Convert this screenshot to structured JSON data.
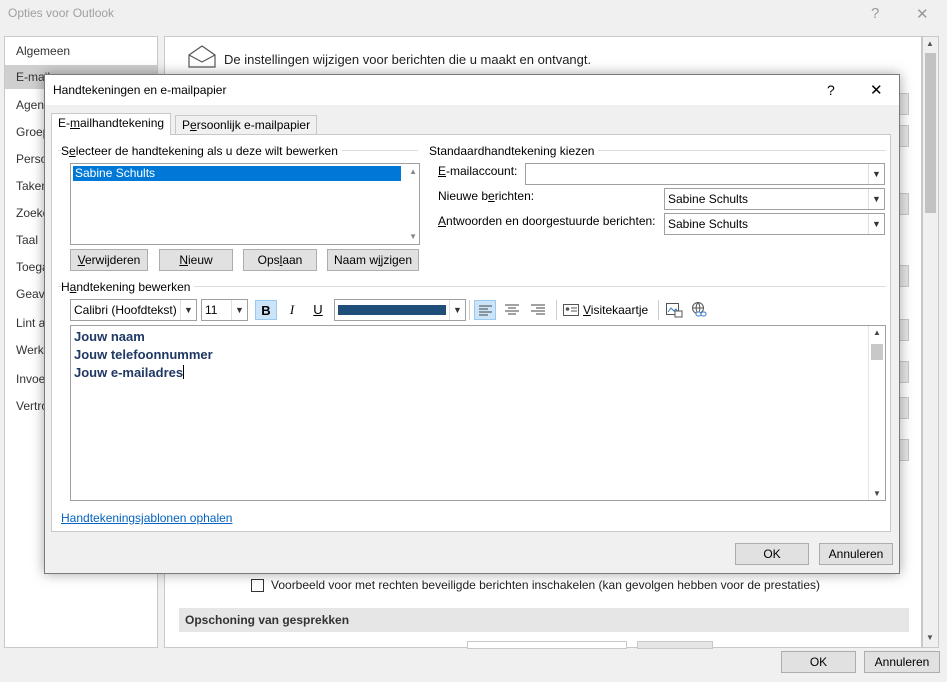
{
  "outer": {
    "title": "Opties voor Outlook",
    "help": "?",
    "close": "✕",
    "sidebar": [
      "Algemeen",
      "E-mail",
      "Agen",
      "Groep",
      "Perso",
      "Taken",
      "Zoeke",
      "Taal",
      "Toega",
      "Geava",
      "Lint a",
      "Werkb",
      "Invoe",
      "Vertro"
    ],
    "header_text": "De instellingen wijzigen voor berichten die u maakt en ontvangt.",
    "checkbox_label": "Voorbeeld voor met rechten beveiligde berichten inschakelen (kan gevolgen hebben voor de prestaties)",
    "section_cleanup": "Opschoning van gesprekken",
    "ok": "OK",
    "cancel": "Annuleren"
  },
  "dialog": {
    "title": "Handtekeningen en e-mailpapier",
    "help": "?",
    "close": "✕",
    "tabs": [
      "E-mailhandtekening",
      "Persoonlijk e-mailpapier"
    ],
    "select_group": "Selecteer de handtekening als u deze wilt bewerken",
    "signatures": [
      "Sabine Schults"
    ],
    "buttons": {
      "delete": "Verwijderen",
      "new": "Nieuw",
      "save": "Opslaan",
      "rename": "Naam wijzigen"
    },
    "default_group": "Standaardhandtekening kiezen",
    "account_label": "E-mailaccount:",
    "account_value": "",
    "new_label": "Nieuwe berichten:",
    "new_value": "Sabine Schults",
    "reply_label": "Antwoorden en doorgestuurde berichten:",
    "reply_value": "Sabine Schults",
    "edit_group": "Handtekening bewerken",
    "font": "Calibri (Hoofdtekst)",
    "size": "11",
    "bold": "B",
    "italic": "I",
    "underline": "U",
    "font_color": "#1f4e79",
    "business_card": "Visitekaartje",
    "signature_lines": [
      "Jouw naam",
      "Jouw telefoonnummer",
      "Jouw e-mailadres"
    ],
    "template_link": "Handtekeningsjablonen ophalen",
    "ok": "OK",
    "cancel": "Annuleren"
  }
}
